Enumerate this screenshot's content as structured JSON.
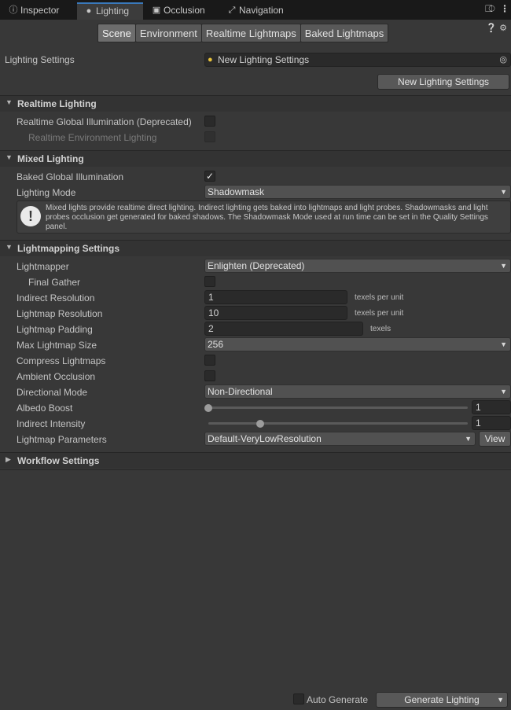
{
  "tabs": [
    {
      "label": "Inspector",
      "icon": "info-icon"
    },
    {
      "label": "Lighting",
      "icon": "bulb-icon"
    },
    {
      "label": "Occlusion",
      "icon": "occlusion-icon"
    },
    {
      "label": "Navigation",
      "icon": "navigation-icon"
    }
  ],
  "subtabs": [
    "Scene",
    "Environment",
    "Realtime Lightmaps",
    "Baked Lightmaps"
  ],
  "lighting_settings": {
    "label": "Lighting Settings",
    "asset": "New Lighting Settings",
    "new_button": "New Lighting Settings"
  },
  "realtime": {
    "title": "Realtime Lighting",
    "gi_label": "Realtime Global Illumination (Deprecated)",
    "env_label": "Realtime Environment Lighting"
  },
  "mixed": {
    "title": "Mixed Lighting",
    "baked_gi_label": "Baked Global Illumination",
    "mode_label": "Lighting Mode",
    "mode_value": "Shadowmask",
    "help_text": "Mixed lights provide realtime direct lighting. Indirect lighting gets baked into lightmaps and light probes. Shadowmasks and light probes occlusion get generated for baked shadows. The Shadowmask Mode used at run time can be set in the Quality Settings panel."
  },
  "lightmapping": {
    "title": "Lightmapping Settings",
    "lightmapper_label": "Lightmapper",
    "lightmapper_value": "Enlighten (Deprecated)",
    "final_gather_label": "Final Gather",
    "indirect_res_label": "Indirect Resolution",
    "indirect_res_value": "1",
    "indirect_res_unit": "texels per unit",
    "lightmap_res_label": "Lightmap Resolution",
    "lightmap_res_value": "10",
    "lightmap_res_unit": "texels per unit",
    "padding_label": "Lightmap Padding",
    "padding_value": "2",
    "padding_unit": "texels",
    "max_size_label": "Max Lightmap Size",
    "max_size_value": "256",
    "compress_label": "Compress Lightmaps",
    "ao_label": "Ambient Occlusion",
    "directional_label": "Directional Mode",
    "directional_value": "Non-Directional",
    "albedo_label": "Albedo Boost",
    "albedo_value": "1",
    "albedo_level": 0.0,
    "indirect_intensity_label": "Indirect Intensity",
    "indirect_intensity_value": "1",
    "indirect_intensity_level": 0.2,
    "params_label": "Lightmap Parameters",
    "params_value": "Default-VeryLowResolution",
    "view_button": "View"
  },
  "workflow": {
    "title": "Workflow Settings"
  },
  "footer": {
    "auto_generate_label": "Auto Generate",
    "generate_button": "Generate Lighting"
  },
  "colors": {
    "background": "#383838",
    "tab_highlight": "#3a79bb",
    "section_header": "#333333"
  }
}
